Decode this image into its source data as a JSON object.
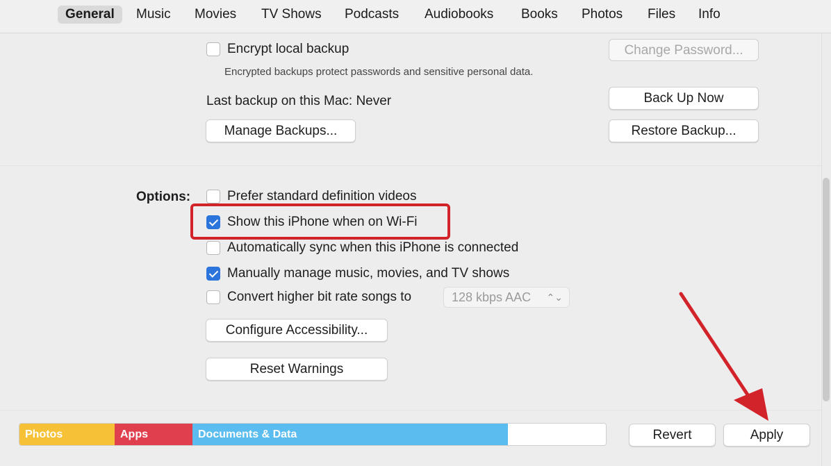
{
  "tabs": [
    {
      "label": "General",
      "active": true
    },
    {
      "label": "Music",
      "active": false
    },
    {
      "label": "Movies",
      "active": false
    },
    {
      "label": "TV Shows",
      "active": false
    },
    {
      "label": "Podcasts",
      "active": false
    },
    {
      "label": "Audiobooks",
      "active": false
    },
    {
      "label": "Books",
      "active": false
    },
    {
      "label": "Photos",
      "active": false
    },
    {
      "label": "Files",
      "active": false
    },
    {
      "label": "Info",
      "active": false
    }
  ],
  "backups": {
    "encrypt_label": "Encrypt local backup",
    "encrypt_checked": false,
    "encrypt_description": "Encrypted backups protect passwords and sensitive personal data.",
    "change_password_label": "Change Password...",
    "last_backup": "Last backup on this Mac:  Never",
    "back_up_now_label": "Back Up Now",
    "manage_backups_label": "Manage Backups...",
    "restore_backup_label": "Restore Backup..."
  },
  "options": {
    "heading": "Options:",
    "items": [
      {
        "label": "Prefer standard definition videos",
        "checked": false
      },
      {
        "label": "Show this iPhone when on Wi-Fi",
        "checked": true
      },
      {
        "label": "Automatically sync when this iPhone is connected",
        "checked": false
      },
      {
        "label": "Manually manage music, movies, and TV shows",
        "checked": true
      },
      {
        "label": "Convert higher bit rate songs to",
        "checked": false
      }
    ],
    "bitrate_value": "128 kbps AAC",
    "configure_accessibility_label": "Configure Accessibility...",
    "reset_warnings_label": "Reset Warnings"
  },
  "storage": {
    "segments": [
      {
        "label": "Photos",
        "color": "#f6c136",
        "fraction": 0.161
      },
      {
        "label": "Apps",
        "color": "#e0404e",
        "fraction": 0.132
      },
      {
        "label": "Documents & Data",
        "color": "#5bbcf0",
        "fraction": 0.537
      },
      {
        "label": "",
        "color": "#ffffff",
        "fraction": 0.17
      }
    ]
  },
  "footer": {
    "revert_label": "Revert",
    "apply_label": "Apply"
  },
  "colors": {
    "accent": "#2a74dc",
    "highlight": "#d3232a"
  }
}
